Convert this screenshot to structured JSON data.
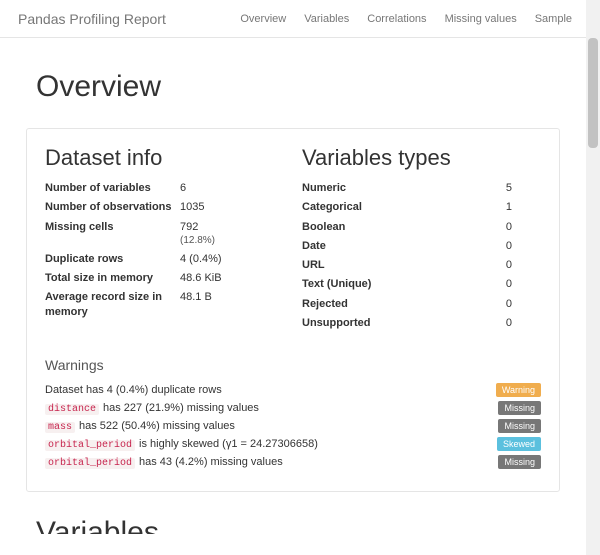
{
  "brand": "Pandas Profiling Report",
  "nav": {
    "overview": "Overview",
    "variables": "Variables",
    "correlations": "Correlations",
    "missing": "Missing values",
    "sample": "Sample"
  },
  "page_title": "Overview",
  "dataset_info": {
    "heading": "Dataset info",
    "rows": {
      "n_vars": {
        "label": "Number of variables",
        "value": "6"
      },
      "n_obs": {
        "label": "Number of observations",
        "value": "1035"
      },
      "missing": {
        "label": "Missing cells",
        "value": "792",
        "sub": "(12.8%)"
      },
      "dupes": {
        "label": "Duplicate rows",
        "value": "4 (0.4%)"
      },
      "total_mem": {
        "label": "Total size in memory",
        "value": "48.6 KiB"
      },
      "avg_rec": {
        "label": "Average record size in memory",
        "value": "48.1 B"
      }
    }
  },
  "var_types": {
    "heading": "Variables types",
    "rows": {
      "numeric": {
        "label": "Numeric",
        "value": "5"
      },
      "categorical": {
        "label": "Categorical",
        "value": "1"
      },
      "boolean": {
        "label": "Boolean",
        "value": "0"
      },
      "date": {
        "label": "Date",
        "value": "0"
      },
      "url": {
        "label": "URL",
        "value": "0"
      },
      "text": {
        "label": "Text (Unique)",
        "value": "0"
      },
      "rejected": {
        "label": "Rejected",
        "value": "0"
      },
      "unsupported": {
        "label": "Unsupported",
        "value": "0"
      }
    }
  },
  "warnings": {
    "heading": "Warnings",
    "items": {
      "w0": {
        "var": "",
        "text": "Dataset has 4 (0.4%) duplicate rows",
        "badge": "Warning",
        "badge_class": "warning"
      },
      "w1": {
        "var": "distance",
        "text": "has 227 (21.9%) missing values",
        "badge": "Missing",
        "badge_class": "missing"
      },
      "w2": {
        "var": "mass",
        "text": "has 522 (50.4%) missing values",
        "badge": "Missing",
        "badge_class": "missing"
      },
      "w3": {
        "var": "orbital_period",
        "text": "is highly skewed (γ1 = 24.27306658)",
        "badge": "Skewed",
        "badge_class": "skewed"
      },
      "w4": {
        "var": "orbital_period",
        "text": "has 43 (4.2%) missing values",
        "badge": "Missing",
        "badge_class": "missing"
      }
    }
  },
  "next_section": "Variables"
}
